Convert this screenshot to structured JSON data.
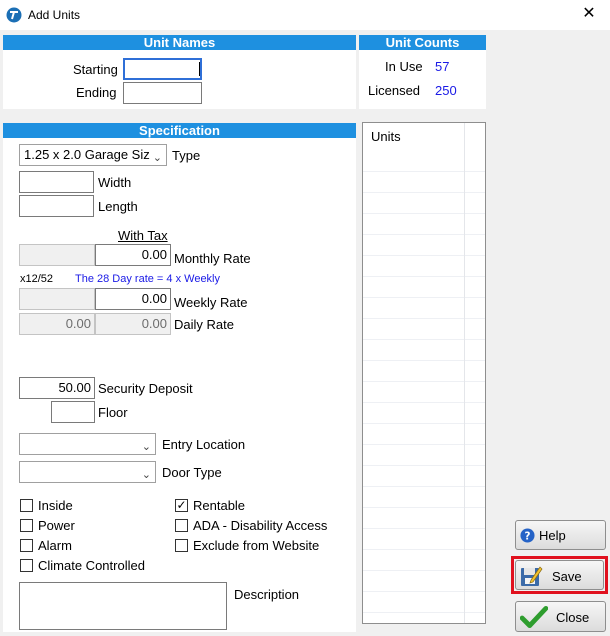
{
  "window": {
    "title": "Add Units",
    "close_glyph": "✕"
  },
  "unit_names": {
    "header": "Unit Names",
    "starting_label": "Starting",
    "starting_value": "",
    "ending_label": "Ending",
    "ending_value": ""
  },
  "unit_counts": {
    "header": "Unit Counts",
    "in_use_label": "In Use",
    "in_use_value": "57",
    "licensed_label": "Licensed",
    "licensed_value": "250"
  },
  "specification": {
    "header": "Specification",
    "type_value": "1.25 x 2.0 Garage Siz",
    "type_label": "Type",
    "width_label": "Width",
    "width_value": "",
    "length_label": "Length",
    "length_value": "",
    "with_tax_label": "With Tax",
    "monthly_rate_value": "0.00",
    "monthly_rate_label": "Monthly Rate",
    "x12_52": "x12/52",
    "day28_note": "The 28 Day rate = 4 x Weekly",
    "weekly_rate_value": "0.00",
    "weekly_rate_label": "Weekly Rate",
    "daily_rate_left": "0.00",
    "daily_rate_value": "0.00",
    "daily_rate_label": "Daily Rate",
    "security_deposit_value": "50.00",
    "security_deposit_label": "Security Deposit",
    "floor_value": "",
    "floor_label": "Floor",
    "entry_location_value": "",
    "entry_location_label": "Entry Location",
    "door_type_value": "",
    "door_type_label": "Door Type",
    "checkboxes_left": [
      {
        "label": "Inside",
        "checked": false
      },
      {
        "label": "Power",
        "checked": false
      },
      {
        "label": "Alarm",
        "checked": false
      },
      {
        "label": "Climate Controlled",
        "checked": false
      }
    ],
    "checkboxes_right": [
      {
        "label": "Rentable",
        "checked": true
      },
      {
        "label": "ADA - Disability Access",
        "checked": false
      },
      {
        "label": "Exclude from Website",
        "checked": false
      }
    ],
    "description_label": "Description",
    "description_value": ""
  },
  "units_list": {
    "header": "Units",
    "rows": []
  },
  "buttons": {
    "help": "Help",
    "save": "Save",
    "close": "Close"
  },
  "colors": {
    "header_blue": "#1e90e0",
    "value_blue": "#1a1ae6",
    "highlight_red": "#e0101e"
  }
}
